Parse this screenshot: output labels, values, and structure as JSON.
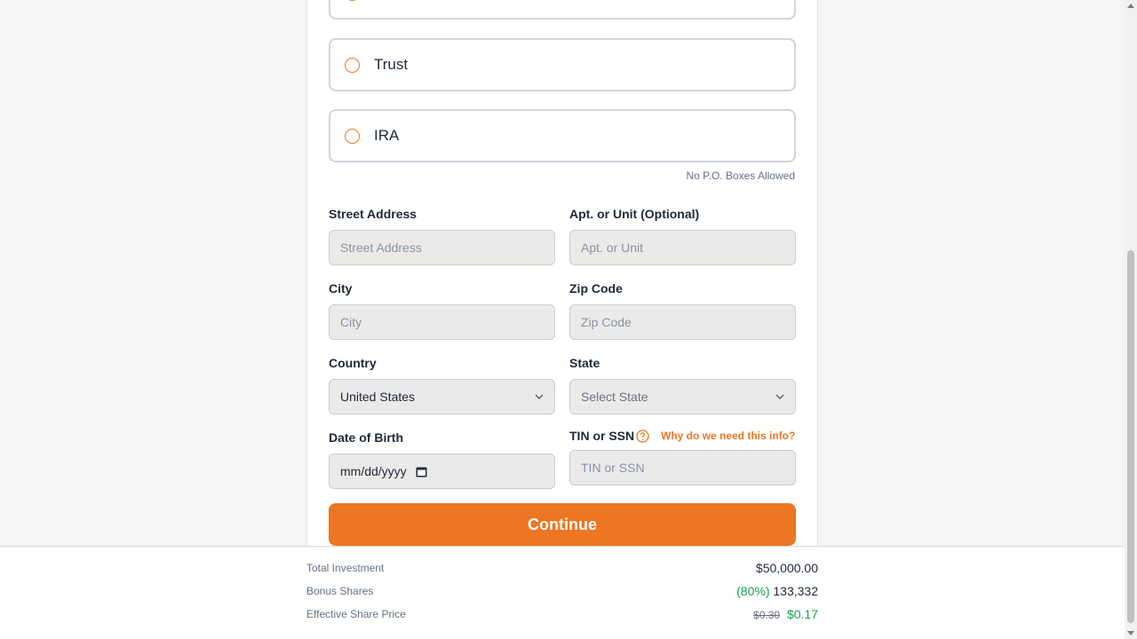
{
  "entity_options": [
    {
      "label": ""
    },
    {
      "label": "Trust"
    },
    {
      "label": "IRA"
    }
  ],
  "address_hint": "No P.O. Boxes Allowed",
  "form": {
    "street": {
      "label": "Street Address",
      "placeholder": "Street Address"
    },
    "apt": {
      "label": "Apt. or Unit (Optional)",
      "placeholder": "Apt. or Unit"
    },
    "city": {
      "label": "City",
      "placeholder": "City"
    },
    "zip": {
      "label": "Zip Code",
      "placeholder": "Zip Code"
    },
    "country": {
      "label": "Country",
      "value": "United States"
    },
    "state": {
      "label": "State",
      "value": "Select State"
    },
    "dob": {
      "label": "Date of Birth",
      "value": "mm/dd/yyyy"
    },
    "tin": {
      "label": "TIN or SSN",
      "placeholder": "TIN or SSN",
      "why_link": "Why do we need this info?"
    }
  },
  "continue_label": "Continue",
  "summary": {
    "total_investment": {
      "label": "Total Investment",
      "value": "$50,000.00"
    },
    "bonus_shares": {
      "label": "Bonus Shares",
      "percent": "(80%)",
      "value": "133,332"
    },
    "effective_price": {
      "label": "Effective Share Price",
      "old": "$0.30",
      "new": "$0.17"
    }
  },
  "colors": {
    "accent": "#ec7622",
    "green": "#16a34a"
  }
}
